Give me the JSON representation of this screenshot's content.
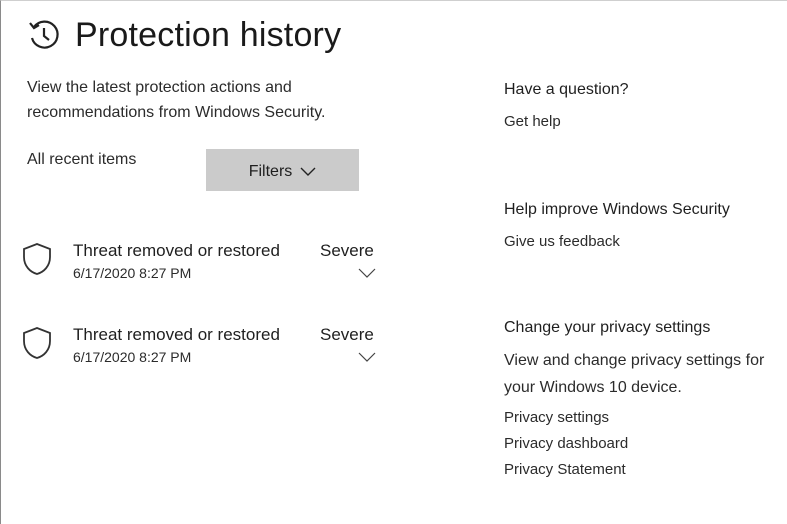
{
  "page": {
    "title": "Protection history",
    "intro": "View the latest protection actions and recommendations from Windows Security.",
    "all_recent_label": "All recent items",
    "filters_label": "Filters"
  },
  "history_items": [
    {
      "title": "Threat removed or restored",
      "severity": "Severe",
      "date": "6/17/2020 8:27 PM"
    },
    {
      "title": "Threat removed or restored",
      "severity": "Severe",
      "date": "6/17/2020 8:27 PM"
    }
  ],
  "sidebar": {
    "question": {
      "heading": "Have a question?",
      "link": "Get help"
    },
    "improve": {
      "heading": "Help improve Windows Security",
      "link": "Give us feedback"
    },
    "privacy": {
      "heading": "Change your privacy settings",
      "description": "View and change privacy settings for your Windows 10 device.",
      "links": [
        "Privacy settings",
        "Privacy dashboard",
        "Privacy Statement"
      ]
    }
  },
  "icons": {
    "header": "history-icon",
    "item": "shield-icon",
    "expand": "chevron-down-icon"
  }
}
